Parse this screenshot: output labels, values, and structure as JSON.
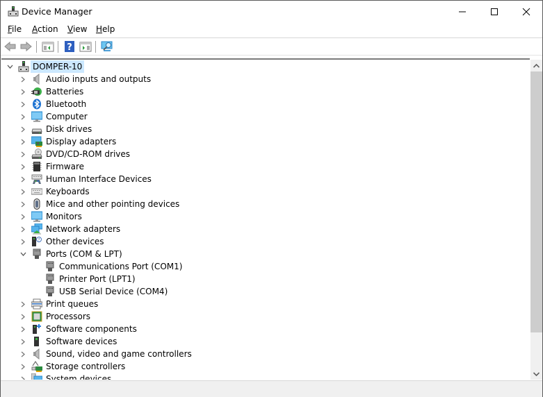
{
  "window": {
    "title": "Device Manager",
    "controls": {
      "minimize": "minimize-icon",
      "maximize": "maximize-icon",
      "close": "close-icon"
    }
  },
  "menu": [
    {
      "label": "File",
      "accel": "F",
      "rest": "ile"
    },
    {
      "label": "Action",
      "accel": "A",
      "rest": "ction"
    },
    {
      "label": "View",
      "accel": "V",
      "rest": "iew"
    },
    {
      "label": "Help",
      "accel": "H",
      "rest": "elp"
    }
  ],
  "toolbar": [
    {
      "name": "back-button",
      "icon": "back-arrow-icon",
      "enabled": false
    },
    {
      "name": "forward-button",
      "icon": "forward-arrow-icon",
      "enabled": false
    },
    {
      "name": "show-hide-console-tree-button",
      "icon": "console-tree-icon"
    },
    {
      "name": "help-button",
      "icon": "help-icon"
    },
    {
      "name": "show-hide-action-pane-button",
      "icon": "action-pane-icon"
    },
    {
      "name": "scan-hardware-button",
      "icon": "scan-hardware-icon"
    }
  ],
  "tree": {
    "root": {
      "label": "DOMPER-10",
      "expanded": true,
      "icon": "computer-tower-icon"
    },
    "items": [
      {
        "label": "Audio inputs and outputs",
        "icon": "speaker-icon",
        "expanded": false
      },
      {
        "label": "Batteries",
        "icon": "battery-icon",
        "expanded": false
      },
      {
        "label": "Bluetooth",
        "icon": "bluetooth-icon",
        "expanded": false
      },
      {
        "label": "Computer",
        "icon": "monitor-icon",
        "expanded": false
      },
      {
        "label": "Disk drives",
        "icon": "disk-drive-icon",
        "expanded": false
      },
      {
        "label": "Display adapters",
        "icon": "display-adapter-icon",
        "expanded": false
      },
      {
        "label": "DVD/CD-ROM drives",
        "icon": "dvd-drive-icon",
        "expanded": false
      },
      {
        "label": "Firmware",
        "icon": "firmware-chip-icon",
        "expanded": false
      },
      {
        "label": "Human Interface Devices",
        "icon": "hid-icon",
        "expanded": false
      },
      {
        "label": "Keyboards",
        "icon": "keyboard-icon",
        "expanded": false
      },
      {
        "label": "Mice and other pointing devices",
        "icon": "mouse-icon",
        "expanded": false
      },
      {
        "label": "Monitors",
        "icon": "monitor-icon",
        "expanded": false
      },
      {
        "label": "Network adapters",
        "icon": "network-adapter-icon",
        "expanded": false
      },
      {
        "label": "Other devices",
        "icon": "unknown-device-icon",
        "expanded": false
      },
      {
        "label": "Ports (COM & LPT)",
        "icon": "port-icon",
        "expanded": true,
        "children": [
          {
            "label": "Communications Port (COM1)",
            "icon": "port-icon"
          },
          {
            "label": "Printer Port (LPT1)",
            "icon": "port-icon"
          },
          {
            "label": "USB Serial Device (COM4)",
            "icon": "port-icon"
          }
        ]
      },
      {
        "label": "Print queues",
        "icon": "printer-icon",
        "expanded": false
      },
      {
        "label": "Processors",
        "icon": "processor-icon",
        "expanded": false
      },
      {
        "label": "Software components",
        "icon": "software-component-icon",
        "expanded": false
      },
      {
        "label": "Software devices",
        "icon": "software-device-icon",
        "expanded": false
      },
      {
        "label": "Sound, video and game controllers",
        "icon": "speaker-icon",
        "expanded": false
      },
      {
        "label": "Storage controllers",
        "icon": "storage-controller-icon",
        "expanded": false
      },
      {
        "label": "System devices",
        "icon": "system-devices-icon",
        "expanded": false
      }
    ]
  },
  "scrollbar": {
    "position_fraction": 0.0,
    "visible_fraction": 0.88
  },
  "status": ""
}
